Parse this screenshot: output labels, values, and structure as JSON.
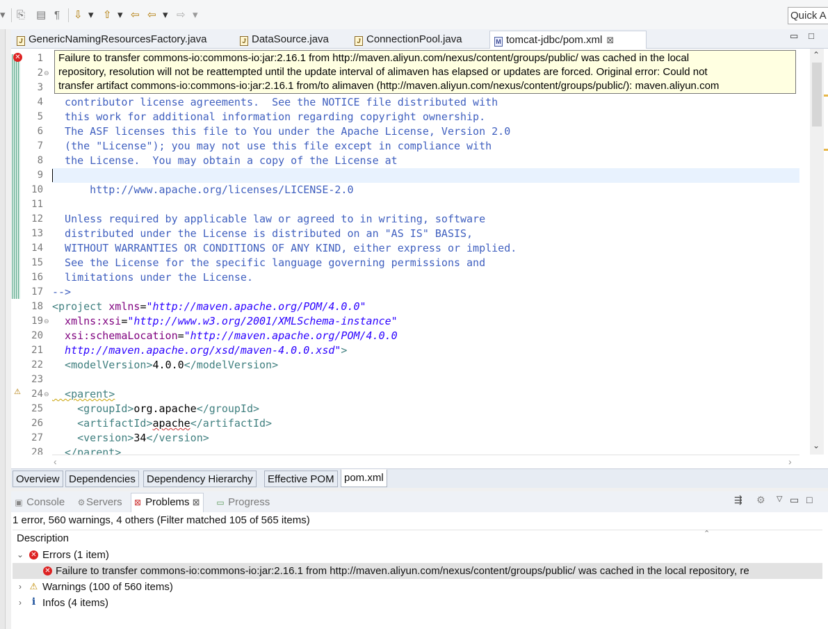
{
  "toolbar": {
    "quick_access": "Quick A"
  },
  "editor": {
    "tabs": [
      {
        "label": "GenericNamingResourcesFactory.java",
        "icon": "java-file-icon"
      },
      {
        "label": "DataSource.java",
        "icon": "java-file-icon"
      },
      {
        "label": "ConnectionPool.java",
        "icon": "java-file-icon"
      },
      {
        "label": "tomcat-jdbc/pom.xml",
        "icon": "maven-pom-icon",
        "active": true,
        "close": "⊠"
      }
    ],
    "tooltip": [
      "Failure to transfer commons-io:commons-io:jar:2.16.1 from http://maven.aliyun.com/nexus/content/groups/public/ was cached in the local",
      "repository, resolution will not be reattempted until the update interval of alimaven has elapsed or updates are forced. Original error: Could not",
      "transfer artifact commons-io:commons-io:jar:2.16.1 from/to alimaven (http://maven.aliyun.com/nexus/content/groups/public/): maven.aliyun.com"
    ],
    "line_numbers": [
      "1",
      "2",
      "3",
      "4",
      "5",
      "6",
      "7",
      "8",
      "9",
      "10",
      "11",
      "12",
      "13",
      "14",
      "15",
      "16",
      "17",
      "18",
      "19",
      "20",
      "21",
      "22",
      "23",
      "24",
      "25",
      "26",
      "27",
      "28"
    ],
    "code": {
      "l4": "  contributor license agreements.  See the NOTICE file distributed with",
      "l5": "  this work for additional information regarding copyright ownership.",
      "l6": "  The ASF licenses this file to You under the Apache License, Version 2.0",
      "l7": "  (the \"License\"); you may not use this file except in compliance with",
      "l8": "  the License.  You may obtain a copy of the License at",
      "l10": "      http://www.apache.org/licenses/LICENSE-2.0",
      "l12": "  Unless required by applicable law or agreed to in writing, software",
      "l13": "  distributed under the License is distributed on an \"AS IS\" BASIS,",
      "l14": "  WITHOUT WARRANTIES OR CONDITIONS OF ANY KIND, either express or implied.",
      "l15": "  See the License for the specific language governing permissions and",
      "l16": "  limitations under the License.",
      "l17": "-->",
      "l18_tag": "<project",
      "l18_attr": " xmlns",
      "l18_eq": "=",
      "l18_val": "\"http://maven.apache.org/POM/4.0.0\"",
      "l19_attr": "  xmlns:xsi",
      "l19_eq": "=",
      "l19_val": "\"http://www.w3.org/2001/XMLSchema-instance\"",
      "l20_attr": "  xsi:schemaLocation",
      "l20_eq": "=",
      "l20_val": "\"http://maven.apache.org/POM/4.0.0",
      "l21_val": "  http://maven.apache.org/xsd/maven-4.0.0.xsd\"",
      "l21_tag": ">",
      "l22_open": "  <modelVersion>",
      "l22_txt": "4.0.0",
      "l22_close": "</modelVersion>",
      "l24_tag": "  <parent>",
      "l25_open": "    <groupId>",
      "l25_txt": "org.apache",
      "l25_close": "</groupId>",
      "l26_open": "    <artifactId>",
      "l26_txt": "apache",
      "l26_close": "</artifactId>",
      "l27_open": "    <version>",
      "l27_txt": "34",
      "l27_close": "</version>",
      "l28_tag": "  </parent>"
    },
    "pom_tabs": [
      "Overview",
      "Dependencies",
      "Dependency Hierarchy",
      "Effective POM",
      "pom.xml"
    ]
  },
  "panel": {
    "tabs": [
      {
        "label": "Console",
        "icon": "console-icon"
      },
      {
        "label": "Servers",
        "icon": "servers-icon"
      },
      {
        "label": "Problems",
        "icon": "problems-icon",
        "active": true,
        "close": "⊠"
      },
      {
        "label": "Progress",
        "icon": "progress-icon"
      }
    ],
    "summary": "1 error, 560 warnings, 4 others (Filter matched 105 of 565 items)",
    "column": "Description",
    "tree": {
      "errors": "Errors (1 item)",
      "error_item": "Failure to transfer commons-io:commons-io:jar:2.16.1 from http://maven.aliyun.com/nexus/content/groups/public/ was cached in the local repository, re",
      "warnings": "Warnings (100 of 560 items)",
      "infos": "Infos (4 items)"
    }
  },
  "colors": {
    "comment": "#3f5fbf",
    "tag": "#3f7f7f",
    "attr": "#7f007f",
    "string": "#2a00ff",
    "error": "#dd2222",
    "warning": "#c08a00",
    "tooltip_bg": "#ffffe1"
  }
}
